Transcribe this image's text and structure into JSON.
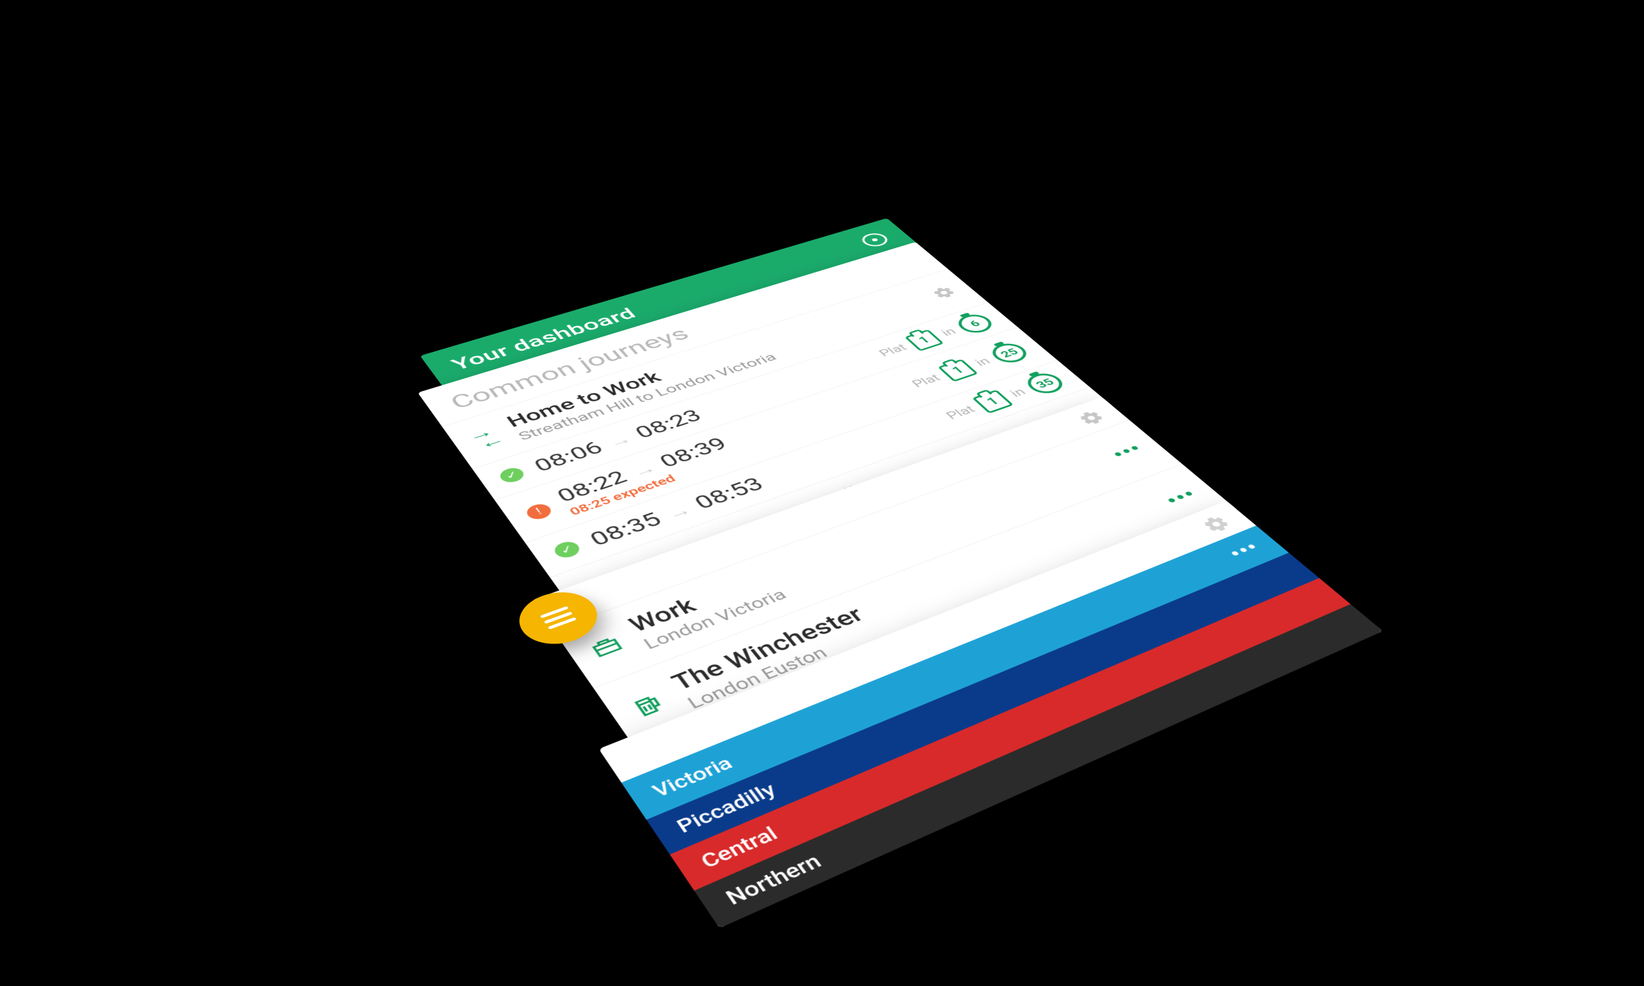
{
  "colors": {
    "brand_green": "#1aab6b",
    "accent_green": "#13a05f",
    "ok_green": "#6ecf5f",
    "warn_orange": "#f26d3d",
    "fab_amber": "#f5b500"
  },
  "header": {
    "title": "Your dashboard"
  },
  "journeys_card": {
    "section_title": "Common journeys",
    "journey": {
      "name": "Home to Work",
      "subtitle": "Streatham Hill to London Victoria"
    },
    "departures": [
      {
        "status": "ok",
        "depart": "08:06",
        "arrive": "08:23",
        "expected": "",
        "platform_label": "Plat",
        "platform": "1",
        "in_label": "in",
        "minutes": "6"
      },
      {
        "status": "warn",
        "depart": "08:22",
        "arrive": "08:39",
        "expected": "08:25 expected",
        "platform_label": "Plat",
        "platform": "1",
        "in_label": "in",
        "minutes": "25"
      },
      {
        "status": "ok",
        "depart": "08:35",
        "arrive": "08:53",
        "expected": "",
        "platform_label": "Plat",
        "platform": "1",
        "in_label": "in",
        "minutes": "35"
      }
    ]
  },
  "places_card": {
    "items": [
      {
        "icon": "briefcase",
        "name": "Work",
        "subtitle": "London Victoria"
      },
      {
        "icon": "beer",
        "name": "The Winchester",
        "subtitle": "London Euston"
      }
    ]
  },
  "lines_card": {
    "lines": [
      {
        "name": "Victoria",
        "color": "#1ea2d6"
      },
      {
        "name": "Piccadilly",
        "color": "#0a3b8a"
      },
      {
        "name": "Central",
        "color": "#d82a2a"
      },
      {
        "name": "Northern",
        "color": "#2b2b2b"
      }
    ]
  }
}
